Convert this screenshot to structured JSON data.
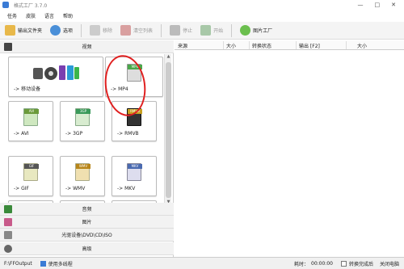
{
  "window": {
    "title": "格式工厂 3.7.0",
    "controls": [
      "—",
      "□",
      "✕"
    ]
  },
  "menu": [
    "任务",
    "皮肤",
    "语言",
    "帮助"
  ],
  "toolbar": {
    "output_folder": "输出文件夹",
    "options": "选项",
    "remove": "移除",
    "clear_list": "清空列表",
    "stop": "停止",
    "start": "开始",
    "image_factory": "图片工厂"
  },
  "left": {
    "video_header": "视频",
    "tiles": [
      {
        "label": "-> 移动设备",
        "tag": ""
      },
      {
        "label": "-> MP4",
        "tag": "MP4"
      },
      {
        "label": "-> AVI",
        "tag": "AVI"
      },
      {
        "label": "-> 3GP",
        "tag": "3GP"
      },
      {
        "label": "-> RMVB",
        "tag": "RMVB"
      },
      {
        "label": "-> GIF",
        "tag": "GIF"
      },
      {
        "label": "-> WMV",
        "tag": "WMV"
      },
      {
        "label": "-> MKV",
        "tag": "MKV"
      }
    ],
    "audio_header": "音频",
    "image_header": "图片",
    "disc_header": "光驱设备\\DVD\\CD\\ISO",
    "advanced_header": "高级"
  },
  "right": {
    "columns": [
      "来源",
      "大小",
      "转换状态",
      "输出 [F2]",
      "大小"
    ]
  },
  "status": {
    "path": "F:\\FFOutput",
    "multithread": "使用多线程",
    "elapsed_label": "耗时：",
    "elapsed": "00:00:00",
    "after_convert": "转换完成后",
    "shutdown": "关闭电脑"
  },
  "colors": {
    "accent": "#3a7bd5",
    "annotation": "#e02020"
  }
}
